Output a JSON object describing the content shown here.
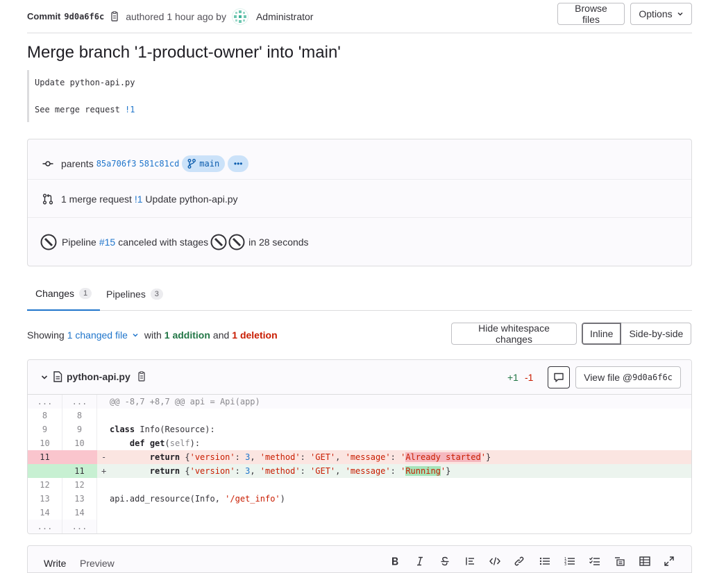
{
  "header": {
    "commit_label": "Commit",
    "sha": "9d0a6f6c",
    "authored": "authored 1 hour ago by",
    "author": "Administrator",
    "browse_files": "Browse files",
    "options": "Options"
  },
  "commit": {
    "title": "Merge branch '1-product-owner' into 'main'",
    "description_line1": "Update python-api.py",
    "description_line2_prefix": "See merge request ",
    "description_line2_link": "!1"
  },
  "info": {
    "parents_label": "parents",
    "parent1": "85a706f3",
    "parent2": "581c81cd",
    "branch": "main",
    "more": "•••",
    "mr_prefix": "1 merge request ",
    "mr_link": "!1",
    "mr_title": " Update python-api.py",
    "pipeline_label": "Pipeline",
    "pipeline_link": "#15",
    "pipeline_status": "canceled with stages",
    "pipeline_duration": "in 28 seconds"
  },
  "tabs": [
    {
      "label": "Changes",
      "count": "1"
    },
    {
      "label": "Pipelines",
      "count": "3"
    }
  ],
  "summary": {
    "showing": "Showing",
    "changed": "1 changed file",
    "with": "with",
    "additions": "1 addition",
    "and": "and",
    "deletions": "1 deletion",
    "hide_ws": "Hide whitespace changes",
    "inline": "Inline",
    "side_by_side": "Side-by-side"
  },
  "file": {
    "name": "python-api.py",
    "plus": "+1",
    "minus": "-1",
    "view_file_prefix": "View file @",
    "view_file_sha": "9d0a6f6c"
  },
  "diff": {
    "hunk": "@@ -8,7 +8,7 @@ api = Api(app)",
    "ellipsis": "...",
    "rows": [
      {
        "old": "8",
        "new": "8"
      },
      {
        "old": "9",
        "new": "9"
      },
      {
        "old": "10",
        "new": "10"
      },
      {
        "old": "11",
        "new": ""
      },
      {
        "old": "",
        "new": "11"
      },
      {
        "old": "12",
        "new": "12"
      },
      {
        "old": "13",
        "new": "13"
      },
      {
        "old": "14",
        "new": "14"
      }
    ]
  },
  "comment": {
    "write": "Write",
    "preview": "Preview"
  },
  "colors": {
    "link": "#1f75cb",
    "addition": "#217645",
    "deletion": "#c91c00",
    "pill_bg": "#cbe2f9"
  }
}
